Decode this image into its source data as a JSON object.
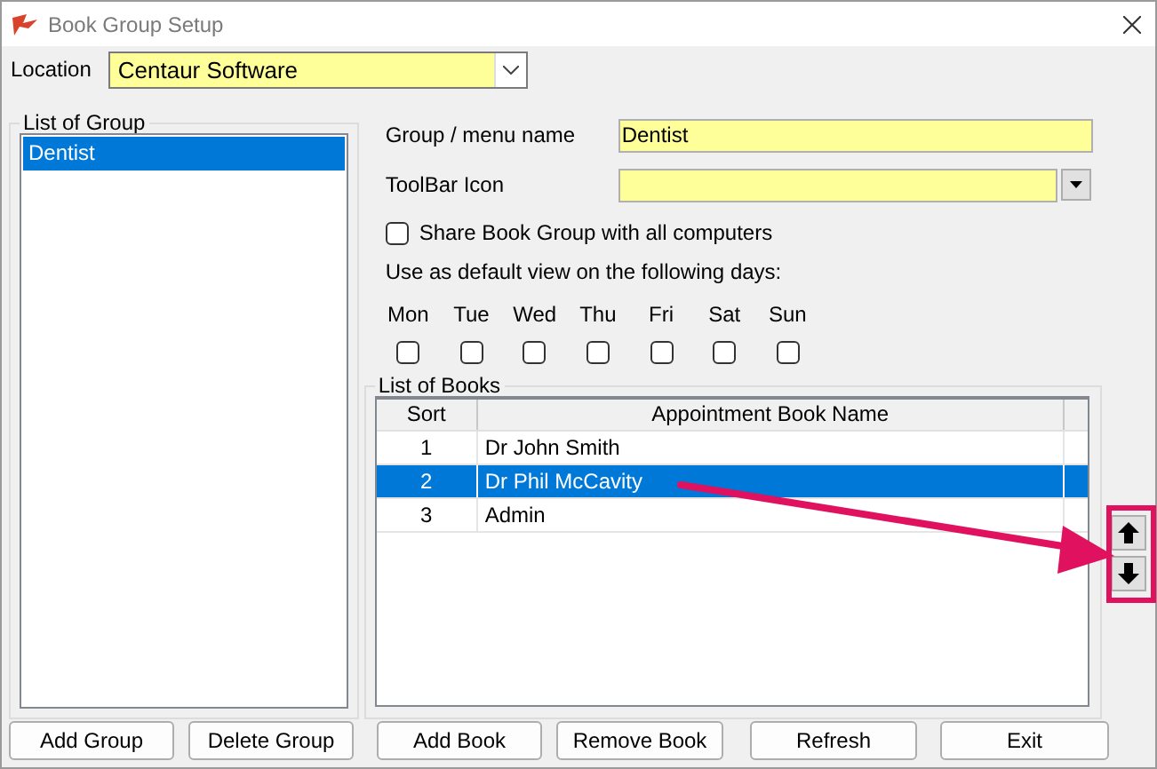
{
  "window": {
    "title": "Book Group Setup"
  },
  "location": {
    "label": "Location",
    "value": "Centaur Software"
  },
  "group_list": {
    "title": "List of Group",
    "items": [
      {
        "label": "Dentist",
        "selected": true
      }
    ]
  },
  "group_name": {
    "label": "Group / menu name",
    "value": "Dentist"
  },
  "toolbar_icon": {
    "label": "ToolBar Icon"
  },
  "share": {
    "label": "Share Book Group with all computers",
    "checked": false
  },
  "default_view": {
    "label": "Use as default view on the following days:",
    "days": [
      {
        "label": "Mon",
        "checked": false
      },
      {
        "label": "Tue",
        "checked": false
      },
      {
        "label": "Wed",
        "checked": false
      },
      {
        "label": "Thu",
        "checked": false
      },
      {
        "label": "Fri",
        "checked": false
      },
      {
        "label": "Sat",
        "checked": false
      },
      {
        "label": "Sun",
        "checked": false
      }
    ]
  },
  "books": {
    "title": "List of Books",
    "columns": [
      "Sort",
      "Appointment Book Name"
    ],
    "rows": [
      {
        "sort": "1",
        "name": "Dr John Smith",
        "selected": false
      },
      {
        "sort": "2",
        "name": "Dr Phil McCavity",
        "selected": true
      },
      {
        "sort": "3",
        "name": "Admin",
        "selected": false
      }
    ]
  },
  "buttons": [
    "Add Group",
    "Delete Group",
    "Add Book",
    "Remove Book",
    "Refresh",
    "Exit"
  ]
}
